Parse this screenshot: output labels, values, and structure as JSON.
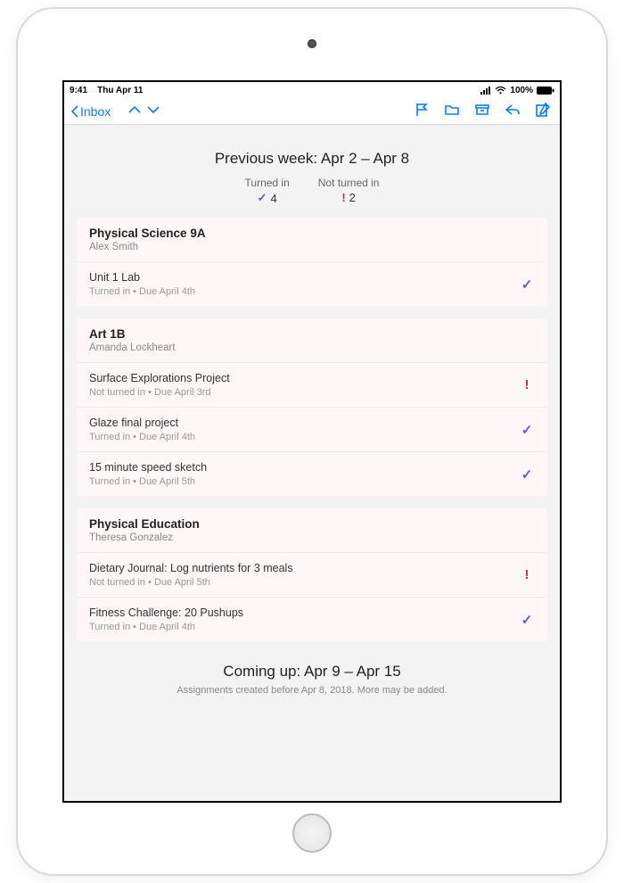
{
  "status": {
    "time": "9:41",
    "date": "Thu Apr 11",
    "battery_text": "100%"
  },
  "toolbar": {
    "back_label": "Inbox"
  },
  "summary": {
    "heading": "Previous week: Apr 2 – Apr 8",
    "turned_in_label": "Turned in",
    "turned_in_count": "4",
    "not_turned_in_label": "Not turned in",
    "not_turned_in_count": "2"
  },
  "groups": [
    {
      "class_name": "Physical Science 9A",
      "teacher": "Alex Smith",
      "assignments": [
        {
          "title": "Unit 1 Lab",
          "meta": "Turned in   •   Due April 4th",
          "status": "ok"
        }
      ]
    },
    {
      "class_name": "Art 1B",
      "teacher": "Amanda Lockheart",
      "assignments": [
        {
          "title": "Surface Explorations Project",
          "meta": "Not turned in   •   Due April 3rd",
          "status": "miss"
        },
        {
          "title": "Glaze final project",
          "meta": "Turned in   •   Due April 4th",
          "status": "ok"
        },
        {
          "title": "15 minute speed sketch",
          "meta": "Turned in   •   Due April 5th",
          "status": "ok"
        }
      ]
    },
    {
      "class_name": "Physical Education",
      "teacher": "Theresa Gonzalez",
      "assignments": [
        {
          "title": "Dietary Journal: Log nutrients for 3 meals",
          "meta": "Not turned in   •   Due April 5th",
          "status": "miss"
        },
        {
          "title": "Fitness Challenge: 20 Pushups",
          "meta": "Turned in   •   Due April 4th",
          "status": "ok"
        }
      ]
    }
  ],
  "coming": {
    "heading": "Coming up: Apr 9 – Apr 15",
    "note": "Assignments created before Apr 8, 2018. More may be added."
  }
}
